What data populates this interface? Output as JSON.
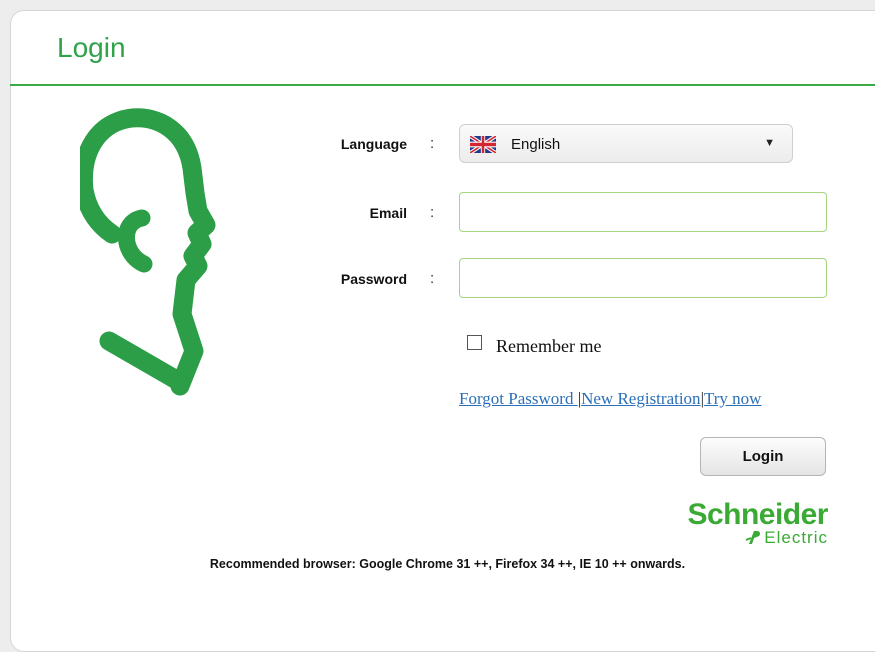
{
  "page": {
    "title": "Login"
  },
  "form": {
    "language_label": "Language",
    "email_label": "Email",
    "password_label": "Password",
    "separator": ":",
    "language_value": "English",
    "email_value": "",
    "password_value": "",
    "remember_label": "Remember me",
    "remember_checked": false,
    "login_button": "Login"
  },
  "links": {
    "forgot": "Forgot Password ",
    "new_registration": "New Registration",
    "try_now": "Try now",
    "separator": "|"
  },
  "brand": {
    "name": "Schneider",
    "sub": "Electric"
  },
  "note": "Recommended browser: Google Chrome 31 ++, Firefox 34 ++, IE 10 ++ onwards.",
  "colors": {
    "accent_green": "#2ea34a",
    "link_blue": "#2b6fb8",
    "field_border": "#a6d57f",
    "brand_green": "#3aaa35"
  },
  "icons": {
    "head_logo": "head-profile-icon",
    "flag": "uk-flag-icon",
    "caret": "dropdown-caret-icon"
  }
}
